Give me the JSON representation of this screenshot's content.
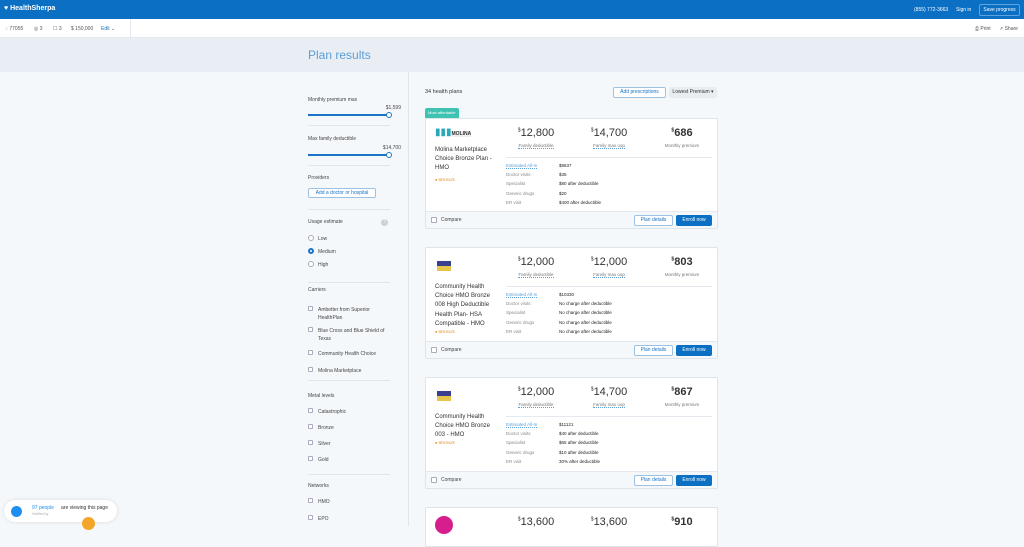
{
  "header": {
    "logo": "HealthSherpa",
    "phone": "(855) 772-3663",
    "sign_in": "Sign in",
    "save_progress": "Save progress"
  },
  "subbar": {
    "zip": "77055",
    "people": "3",
    "household": "3",
    "income": "$ 150,000",
    "edit": "Edit",
    "print": "Print",
    "share": "Share"
  },
  "title": "Plan results",
  "filters": {
    "premium_label": "Monthly premium max",
    "premium_value": "$1,599",
    "deductible_label": "Max family deductible",
    "deductible_value": "$14,700",
    "providers_label": "Providers",
    "add_provider": "Add a doctor or hospital",
    "usage_label": "Usage estimate",
    "usage_options": [
      "Low",
      "Medium",
      "High"
    ],
    "usage_selected": "Medium",
    "carriers_label": "Carriers",
    "carriers": [
      "Ambetter from Superior HealthPlan",
      "Blue Cross and Blue Shield of Texas",
      "Community Health Choice",
      "Molina Marketplace"
    ],
    "metal_label": "Metal levels",
    "metals": [
      "Catastrophic",
      "Bronze",
      "Silver",
      "Gold"
    ],
    "networks_label": "Networks",
    "networks": [
      "HMO",
      "EPO"
    ]
  },
  "results": {
    "count": "34 health plans",
    "add_prescriptions": "Add prescriptions",
    "sort": "Lowest Premium",
    "badge": "Most affordable",
    "labels": {
      "deductible": "Family deductible",
      "moop": "Family max oop",
      "premium": "Monthly premium",
      "est": "Estimated All-In",
      "doctor": "Doctor visits",
      "specialist": "Specialist",
      "generic": "Generic drugs",
      "er": "ER visit",
      "compare": "Compare",
      "details": "Plan details",
      "enroll": "Enroll now",
      "metal": "BRONZE"
    },
    "plans": [
      {
        "name": "Molina Marketplace Choice Bronze Plan - HMO",
        "logo": "MOLINA",
        "deductible": "12,800",
        "moop": "14,700",
        "premium": "686",
        "est": "$8637",
        "doctor": "$35",
        "specialist": "$80 after deductible",
        "generic": "$20",
        "er": "$400 after deductible"
      },
      {
        "name": "Community Health Choice HMO Bronze 008 High Deductible Health Plan- HSA Compatible - HMO",
        "deductible": "12,000",
        "moop": "12,000",
        "premium": "803",
        "est": "$10330",
        "doctor": "No charge after deductible",
        "specialist": "No charge after deductible",
        "generic": "No charge after deductible",
        "er": "No charge after deductible"
      },
      {
        "name": "Community Health Choice HMO Bronze 003 - HMO",
        "deductible": "12,000",
        "moop": "14,700",
        "premium": "867",
        "est": "$11121",
        "doctor": "$40 after deductible",
        "specialist": "$65 after deductible",
        "generic": "$10 after deductible",
        "er": "30% after deductible"
      },
      {
        "deductible": "13,600",
        "moop": "13,600",
        "premium": "910"
      }
    ]
  },
  "toast": {
    "count": "97 people",
    "text": "are viewing this page",
    "sub": "Verified by"
  },
  "colors": {
    "brand": "#0b6fc3",
    "badge": "#3ec3b2",
    "bronze": "#e08a1e"
  }
}
